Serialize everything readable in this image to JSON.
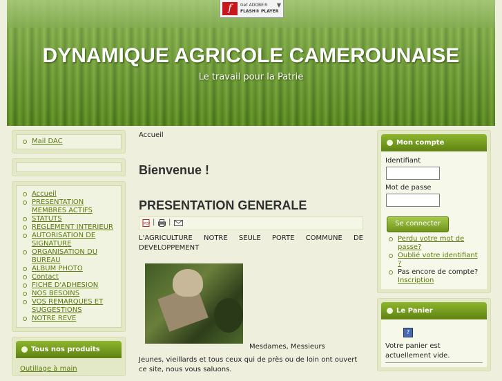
{
  "header": {
    "site_title": "DYNAMIQUE AGRICOLE CAMEROUNAISE",
    "slogan": "Le travail pour la Patrie",
    "flash_line1": "Get ADOBE®",
    "flash_line2": "FLASH® PLAYER"
  },
  "left": {
    "mail_item": "Mail DAC",
    "menu": [
      "Accueil",
      "PRESENTATION MEMBRES ACTIFS",
      "STATUTS",
      "REGLEMENT INTERIEUR",
      "AUTORISATION DE SIGNATURE",
      "ORGANISATION DU BUREAU",
      "ALBUM PHOTO",
      "Contact",
      "FICHE D'ADHESION",
      "NOS BESOINS",
      "VOS REMARQUES ET SUGGESTIONS",
      "NOTRE REVE"
    ],
    "products_title": "Tous nos produits",
    "products_first": "Outillage à main"
  },
  "main": {
    "breadcrumb": "Accueil",
    "welcome": "Bienvenue !",
    "article_title": "PRESENTATION GENERALE",
    "toolbar_sep": "|",
    "intro_line1": "L'AGRICULTURE NOTRE SEULE PORTE COMMUNE DE",
    "intro_line2": "DEVELOPPEMENT",
    "greeting": "Mesdames, Messieurs",
    "para": "Jeunes, vieillards et  tous ceux qui  de près ou de loin ont ouvert ce site, nous vous saluons."
  },
  "right": {
    "account_title": "Mon compte",
    "identifiant_label": "Identifiant",
    "password_label": "Mot de passe",
    "login_button": "Se connecter",
    "links": [
      "Perdu votre mot de passe?",
      "Oublié votre identifiant ?"
    ],
    "no_account_text": "Pas encore de compte?",
    "register_link": "Inscription",
    "cart_title": "Le Panier",
    "cart_icon": "?",
    "cart_text": "Votre panier est actuellement vide."
  }
}
